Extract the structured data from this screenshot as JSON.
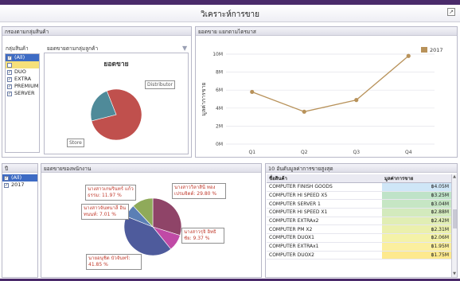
{
  "window": {
    "title": "วิเคราะห์การขาย"
  },
  "group_filter_panel": {
    "header": "กรองตามกลุ่มสินค้า",
    "list_label": "กลุ่มสินค้า",
    "items": [
      {
        "label": "(All)",
        "checked": true,
        "selected": true
      },
      {
        "label": "",
        "checked": false,
        "blank": true
      },
      {
        "label": "DUO",
        "checked": true
      },
      {
        "label": "EXTRA",
        "checked": true
      },
      {
        "label": "PREMIUM",
        "checked": true
      },
      {
        "label": "SERVER",
        "checked": true
      }
    ],
    "pie_section_label": "ยอดขายตามกลุ่มลูกค้า",
    "pie_title": "ยอดขาย",
    "pie_labels": {
      "distributor": "Distributor",
      "store": "Store"
    },
    "pie_slices": [
      {
        "name": "Store",
        "value": 0.77,
        "color": "#c0504d"
      },
      {
        "name": "Distributor",
        "value": 0.23,
        "color": "#4f8a99"
      }
    ]
  },
  "line_panel": {
    "header": "ยอดขาย แยกตามไตรมาส",
    "legend": "2017",
    "ylabel": "มูลค่าการขาย"
  },
  "chart_data": {
    "type": "line",
    "categories": [
      "Q1",
      "Q2",
      "Q3",
      "Q4"
    ],
    "series": [
      {
        "name": "2017",
        "values": [
          5.8,
          3.6,
          4.9,
          9.8
        ],
        "color": "#b8925a"
      }
    ],
    "yticks": [
      "0M",
      "2M",
      "4M",
      "6M",
      "8M",
      "10M"
    ],
    "ylim": [
      0,
      10
    ],
    "ylabel": "มูลค่าการขาย",
    "legend_position": "top-right"
  },
  "year_filter": {
    "header": "ปี",
    "items": [
      {
        "label": "(All)",
        "checked": true,
        "selected": true
      },
      {
        "label": "2017",
        "checked": true
      }
    ]
  },
  "salesperson_panel": {
    "header": "ยอดขายของพนักงาน",
    "labels": [
      "นางสาวเกษรินทร์ แก้วธรรม: 11.97 %",
      "นางสาวจันทนาลี อินทนนท์: 7.01 %",
      "นายอนุชิต บัวจันทร์: 41.85 %",
      "นางสาวรุจิ อิทธิชัย: 9.37 %",
      "นางสาววิลาสินี ทองเปรมจิตต์: 29.80 %"
    ],
    "slices": [
      {
        "value": 29.8,
        "color": "#8f4468"
      },
      {
        "value": 9.37,
        "color": "#c04aa6"
      },
      {
        "value": 41.85,
        "color": "#4e5b9c"
      },
      {
        "value": 7.01,
        "color": "#5b7fb5"
      },
      {
        "value": 11.97,
        "color": "#8faa5a"
      }
    ]
  },
  "top10_panel": {
    "header": "10 อันดับมูลค่าการขายสูงสุด",
    "columns": [
      "ชื่อสินค้า",
      "มูลค่าการขาย"
    ],
    "rows": [
      {
        "name": "COMPUTER FINISH GOODS",
        "value": "฿4.05M",
        "color": "#cfe6f7"
      },
      {
        "name": "COMPUTER HI SPEED X5",
        "value": "฿3.25M",
        "color": "#bfe3c8"
      },
      {
        "name": "COMPUTER SERVER 1",
        "value": "฿3.04M",
        "color": "#c6e6c4"
      },
      {
        "name": "COMPUTER HI SPEED X1",
        "value": "฿2.88M",
        "color": "#d3eabd"
      },
      {
        "name": "COMPUTER EXTRAx2",
        "value": "฿2.42M",
        "color": "#e1eeb4"
      },
      {
        "name": "COMPUTER PM X2",
        "value": "฿2.31M",
        "color": "#ebf0ad"
      },
      {
        "name": "COMPUTER DUOX1",
        "value": "฿2.06M",
        "color": "#f4f2a8"
      },
      {
        "name": "COMPUTER EXTRAx1",
        "value": "฿1.95M",
        "color": "#fbef9f"
      },
      {
        "name": "COMPUTER DUOX2",
        "value": "฿1.75M",
        "color": "#fde98e"
      }
    ]
  }
}
